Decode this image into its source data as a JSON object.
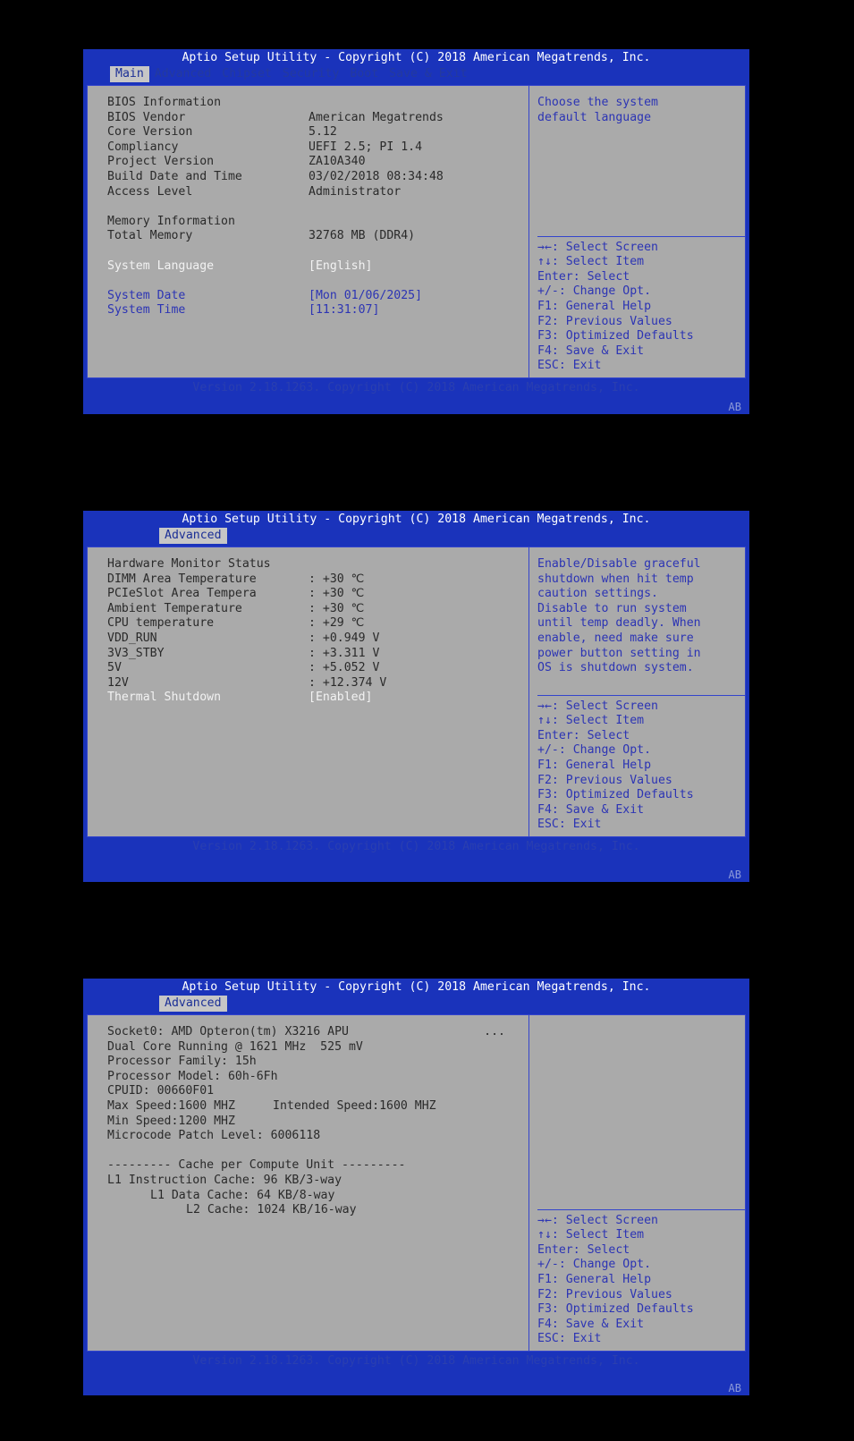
{
  "common": {
    "title": "Aptio Setup Utility - Copyright (C) 2018 American Megatrends, Inc.",
    "footer": "Version 2.18.1263. Copyright (C) 2018 American Megatrends, Inc.",
    "corner_badge": "AB",
    "accent_blue": "#1a33bb",
    "panel_gray": "#aaaaaa",
    "text_blue": "#2c34b4",
    "hints": [
      "→←: Select Screen",
      "↑↓: Select Item",
      "Enter: Select",
      "+/-: Change Opt.",
      "F1: General Help",
      "F2: Previous Values",
      "F3: Optimized Defaults",
      "F4: Save & Exit",
      "ESC: Exit"
    ]
  },
  "screen_main": {
    "tabs": [
      {
        "label": "Main",
        "active": true
      },
      {
        "label": "Advanced",
        "active": false
      },
      {
        "label": "Chipset",
        "active": false
      },
      {
        "label": "Security",
        "active": false
      },
      {
        "label": "Boot",
        "active": false
      },
      {
        "label": "Save & Exit",
        "active": false
      }
    ],
    "section_bios": "BIOS Information",
    "bios_rows": [
      {
        "label": "BIOS Vendor",
        "value": "American Megatrends"
      },
      {
        "label": "Core Version",
        "value": "5.12"
      },
      {
        "label": "Compliancy",
        "value": "UEFI 2.5; PI 1.4"
      },
      {
        "label": "Project Version",
        "value": "ZA10A340"
      },
      {
        "label": "Build Date and Time",
        "value": "03/02/2018 08:34:48"
      },
      {
        "label": "Access Level",
        "value": "Administrator"
      }
    ],
    "section_memory": "Memory Information",
    "memory_rows": [
      {
        "label": "Total Memory",
        "value": "32768 MB (DDR4)"
      }
    ],
    "language_label": "System Language",
    "language_value": "[English]",
    "date_label": "System Date",
    "date_value": "[Mon 01/06/2025]",
    "time_label": "System Time",
    "time_value": "[11:31:07]",
    "help": "Choose the system\ndefault language"
  },
  "screen_hwmon": {
    "tabs": [
      {
        "label": "Advanced",
        "active": true
      }
    ],
    "section_title": "Hardware Monitor Status",
    "sensor_rows": [
      {
        "label": "DIMM Area Temperature",
        "value": ": +30 ℃"
      },
      {
        "label": "PCIeSlot Area Tempera",
        "value": ": +30 ℃"
      },
      {
        "label": "Ambient Temperature",
        "value": ": +30 ℃"
      },
      {
        "label": "CPU temperature",
        "value": ": +29 ℃"
      },
      {
        "label": "VDD_RUN",
        "value": ": +0.949 V"
      },
      {
        "label": "3V3_STBY",
        "value": ": +3.311 V"
      },
      {
        "label": "5V",
        "value": ": +5.052 V"
      },
      {
        "label": "12V",
        "value": ": +12.374 V"
      }
    ],
    "thermal_label": "Thermal Shutdown",
    "thermal_value": "[Enabled]",
    "help": "Enable/Disable graceful\nshutdown when hit temp\ncaution settings.\nDisable to run system\nuntil temp deadly. When\nenable, need make sure\npower button setting in\nOS is shutdown system."
  },
  "screen_cpu": {
    "tabs": [
      {
        "label": "Advanced",
        "active": true
      }
    ],
    "socket_line": "Socket0: AMD Opteron(tm) X3216 APU",
    "overflow_marker": "...",
    "info_rows": [
      "Dual Core Running @ 1621 MHz  525 mV",
      "Processor Family: 15h",
      "Processor Model: 60h-6Fh",
      "CPUID: 00660F01"
    ],
    "speed_row": {
      "max": "Max Speed:1600 MHZ",
      "intended": "Intended Speed:1600 MHZ"
    },
    "min_speed": "Min Speed:1200 MHZ",
    "microcode": "Microcode Patch Level: 6006118",
    "cache_header": "--------- Cache per Compute Unit ---------",
    "cache_rows": [
      {
        "indent": 0,
        "text": "L1 Instruction Cache: 96 KB/3-way"
      },
      {
        "indent": 6,
        "text": "L1 Data Cache: 64 KB/8-way"
      },
      {
        "indent": 11,
        "text": "L2 Cache: 1024 KB/16-way"
      }
    ],
    "help": ""
  }
}
